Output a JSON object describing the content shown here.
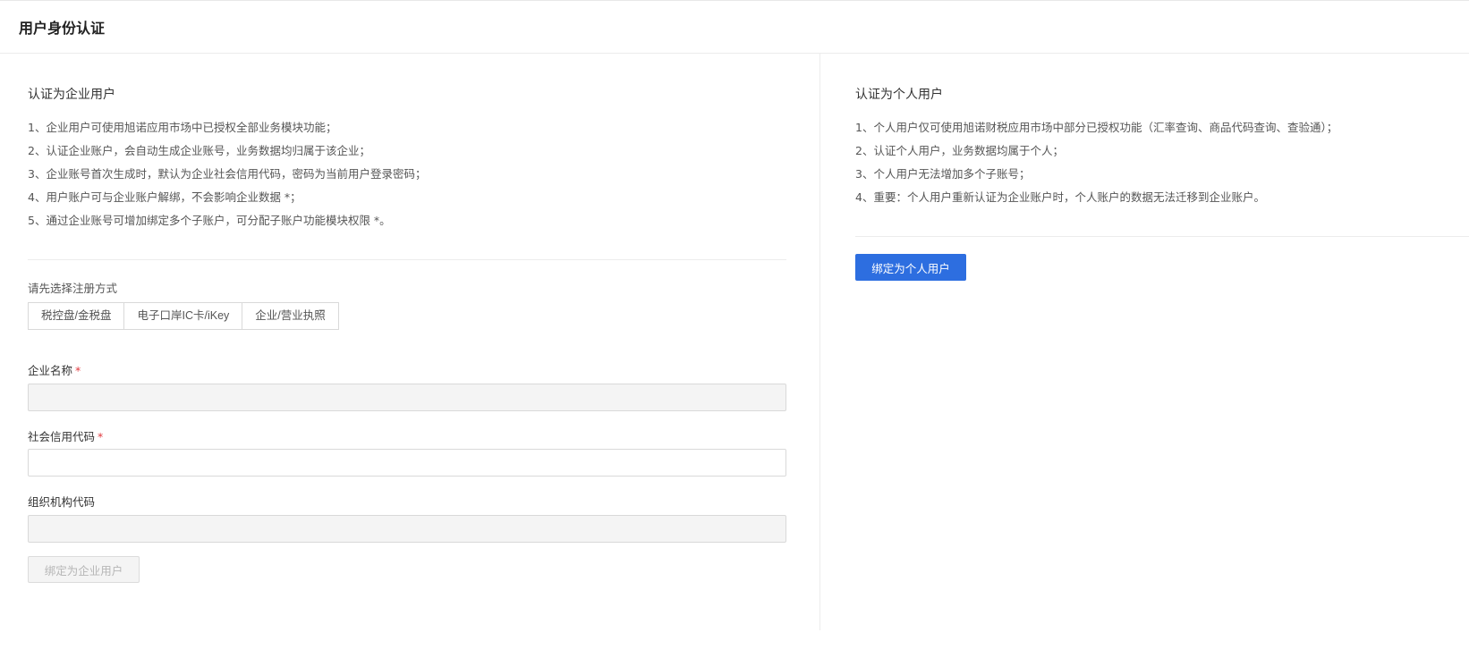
{
  "header": {
    "title": "用户身份认证"
  },
  "enterprise": {
    "title": "认证为企业用户",
    "rules": [
      "1、企业用户可使用旭诺应用市场中已授权全部业务模块功能；",
      "2、认证企业账户，会自动生成企业账号，业务数据均归属于该企业；",
      "3、企业账号首次生成时，默认为企业社会信用代码，密码为当前用户登录密码；",
      "4、用户账户可与企业账户解绑，不会影响企业数据 *；",
      "5、通过企业账号可增加绑定多个子账户，可分配子账户功能模块权限 *。"
    ],
    "method_label": "请先选择注册方式",
    "methods": [
      "税控盘/金税盘",
      "电子口岸IC卡/iKey",
      "企业/营业执照"
    ],
    "fields": {
      "company_name": {
        "label": "企业名称",
        "required": "*",
        "value": ""
      },
      "credit_code": {
        "label": "社会信用代码",
        "required": "*",
        "value": ""
      },
      "org_code": {
        "label": "组织机构代码",
        "value": ""
      }
    },
    "submit_label": "绑定为企业用户"
  },
  "personal": {
    "title": "认证为个人用户",
    "rules": [
      "1、个人用户仅可使用旭诺财税应用市场中部分已授权功能（汇率查询、商品代码查询、查验通）；",
      "2、认证个人用户，业务数据均属于个人；",
      "3、个人用户无法增加多个子账号；",
      "4、重要：个人用户重新认证为企业账户时，个人账户的数据无法迁移到企业账户。"
    ],
    "submit_label": "绑定为个人用户"
  },
  "colors": {
    "primary": "#2d6ee0",
    "required": "#e0393e",
    "disabled_bg": "#f4f4f4",
    "border": "#d9d9d9"
  }
}
